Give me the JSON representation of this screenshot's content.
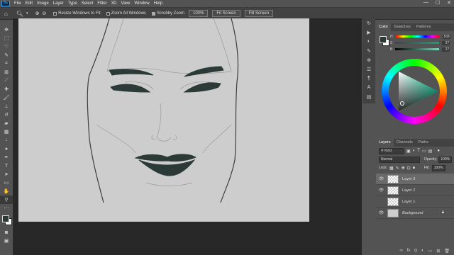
{
  "app": {
    "logo": "Ps"
  },
  "menu": [
    "File",
    "Edit",
    "Image",
    "Layer",
    "Type",
    "Select",
    "Filter",
    "3D",
    "View",
    "Window",
    "Help"
  ],
  "options": {
    "resize_label": "Resize Windows to Fit",
    "zoom_all_label": "Zoom All Windows",
    "scrubby_label": "Scrubby Zoom",
    "zoom_value": "100%",
    "fit_screen": "Fit Screen",
    "fill_screen": "Fill Screen"
  },
  "color_panel": {
    "tabs": [
      "Color",
      "Swatches",
      "Patterns"
    ],
    "h_value": "168",
    "s_value": "27",
    "b_value": "27",
    "foreground": "#2b3a36",
    "background": "#ffffff"
  },
  "layers_panel": {
    "tabs": [
      "Layers",
      "Channels",
      "Paths"
    ],
    "kind": "Kind",
    "blend_mode": "Normal",
    "opacity_label": "Opacity:",
    "opacity": "100%",
    "lock_label": "Lock:",
    "fill_label": "Fill:",
    "fill": "100%",
    "layers": [
      {
        "name": "Layer 3",
        "visible": true,
        "selected": true
      },
      {
        "name": "Layer 2",
        "visible": true,
        "selected": false
      },
      {
        "name": "Layer 1",
        "visible": false,
        "selected": false
      },
      {
        "name": "Background",
        "visible": true,
        "selected": false,
        "locked": true
      }
    ]
  },
  "colors": {
    "accent": "#2f9cf1",
    "ink": "#2b3a36"
  }
}
